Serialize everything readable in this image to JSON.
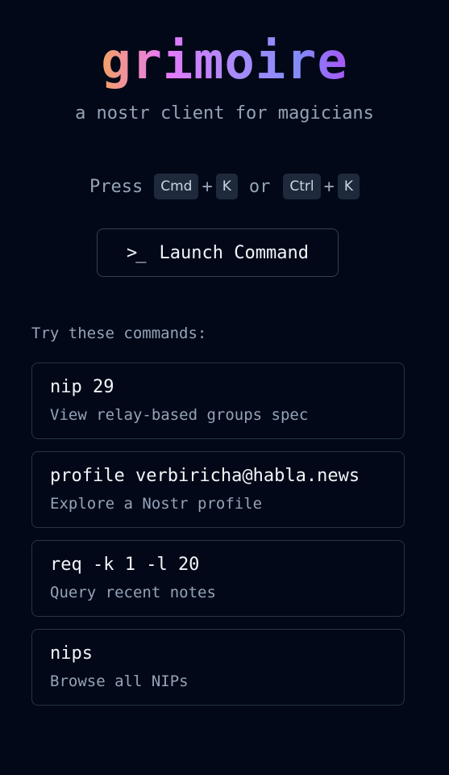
{
  "app": {
    "logo": "grimoire",
    "tagline": "a nostr client for magicians"
  },
  "shortcut": {
    "press": "Press",
    "key1": "Cmd",
    "plus1": "+",
    "key2": "K",
    "or": "or",
    "key3": "Ctrl",
    "plus2": "+",
    "key4": "K"
  },
  "launch": {
    "icon": ">_",
    "label": "Launch Command"
  },
  "suggestions": {
    "heading": "Try these commands:",
    "items": [
      {
        "command": "nip 29",
        "description": "View relay-based groups spec"
      },
      {
        "command": "profile verbiricha@habla.news",
        "description": "Explore a Nostr profile"
      },
      {
        "command": "req -k 1 -l 20",
        "description": "Query recent notes"
      },
      {
        "command": "nips",
        "description": "Browse all NIPs"
      }
    ]
  },
  "colors": {
    "background": "#020817",
    "border": "#334155",
    "muted_text": "#94a3b8",
    "logo_gradient": [
      "#f4a261",
      "#e879f9",
      "#a78bfa",
      "#818cf8",
      "#a855f7"
    ]
  }
}
